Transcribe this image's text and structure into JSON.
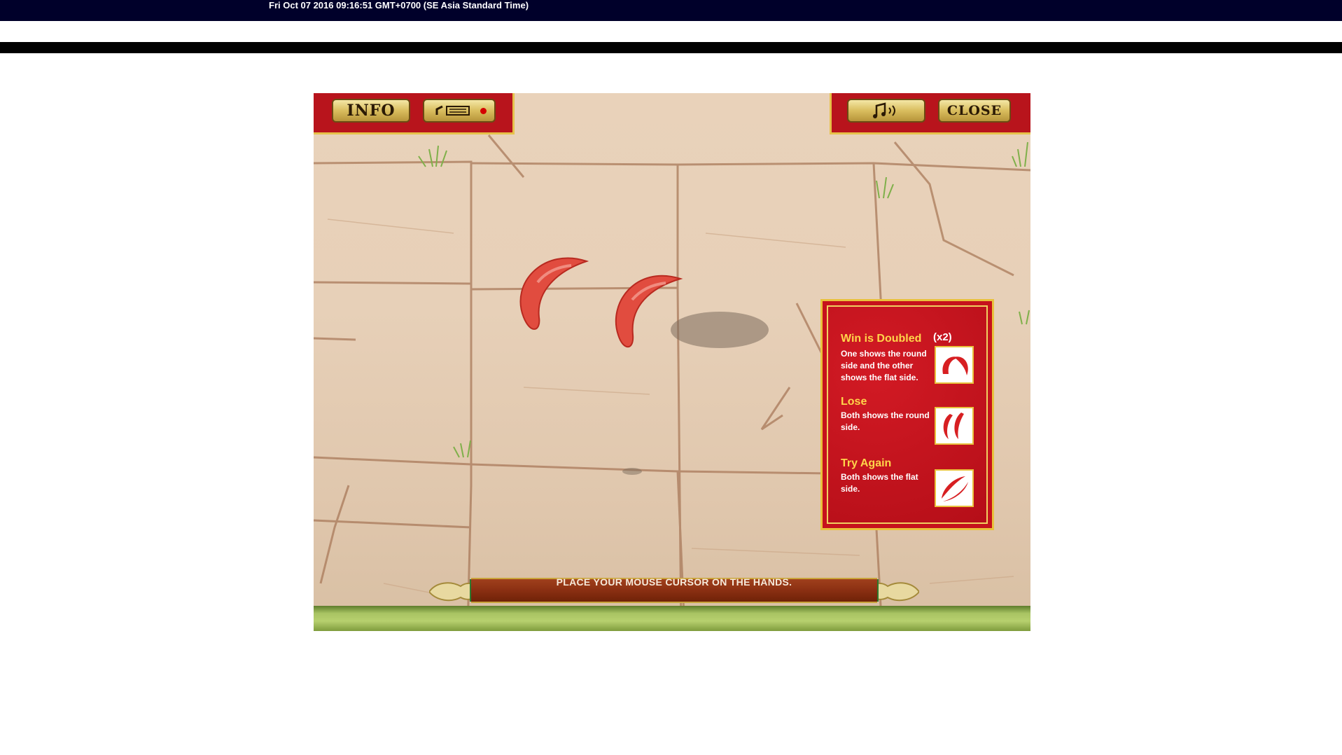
{
  "header": {
    "timestamp": "Fri Oct 07 2016 09:16:51 GMT+0700 (SE Asia Standard Time)"
  },
  "toolbar": {
    "info_label": "INFO",
    "close_label": "CLOSE",
    "buttons": [
      "info",
      "replay-record",
      "sound",
      "close"
    ]
  },
  "help_panel": {
    "win": {
      "title": "Win is Doubled",
      "multiplier": "(x2)",
      "text": [
        "One shows the round",
        "side and the other",
        "shows the flat side."
      ]
    },
    "lose": {
      "title": "Lose",
      "text": [
        "Both shows the round",
        "side."
      ]
    },
    "try_again": {
      "title": "Try Again",
      "text": [
        "Both shows the flat",
        "side."
      ]
    }
  },
  "banner": {
    "text": "PLACE YOUR MOUSE CURSOR ON THE HANDS."
  },
  "colors": {
    "header_bg": "#00002a",
    "panel_red": "#b8141c",
    "gold": "#e6c24a",
    "wall": "#e7d0b8",
    "blocks_red": "#e24b40"
  }
}
